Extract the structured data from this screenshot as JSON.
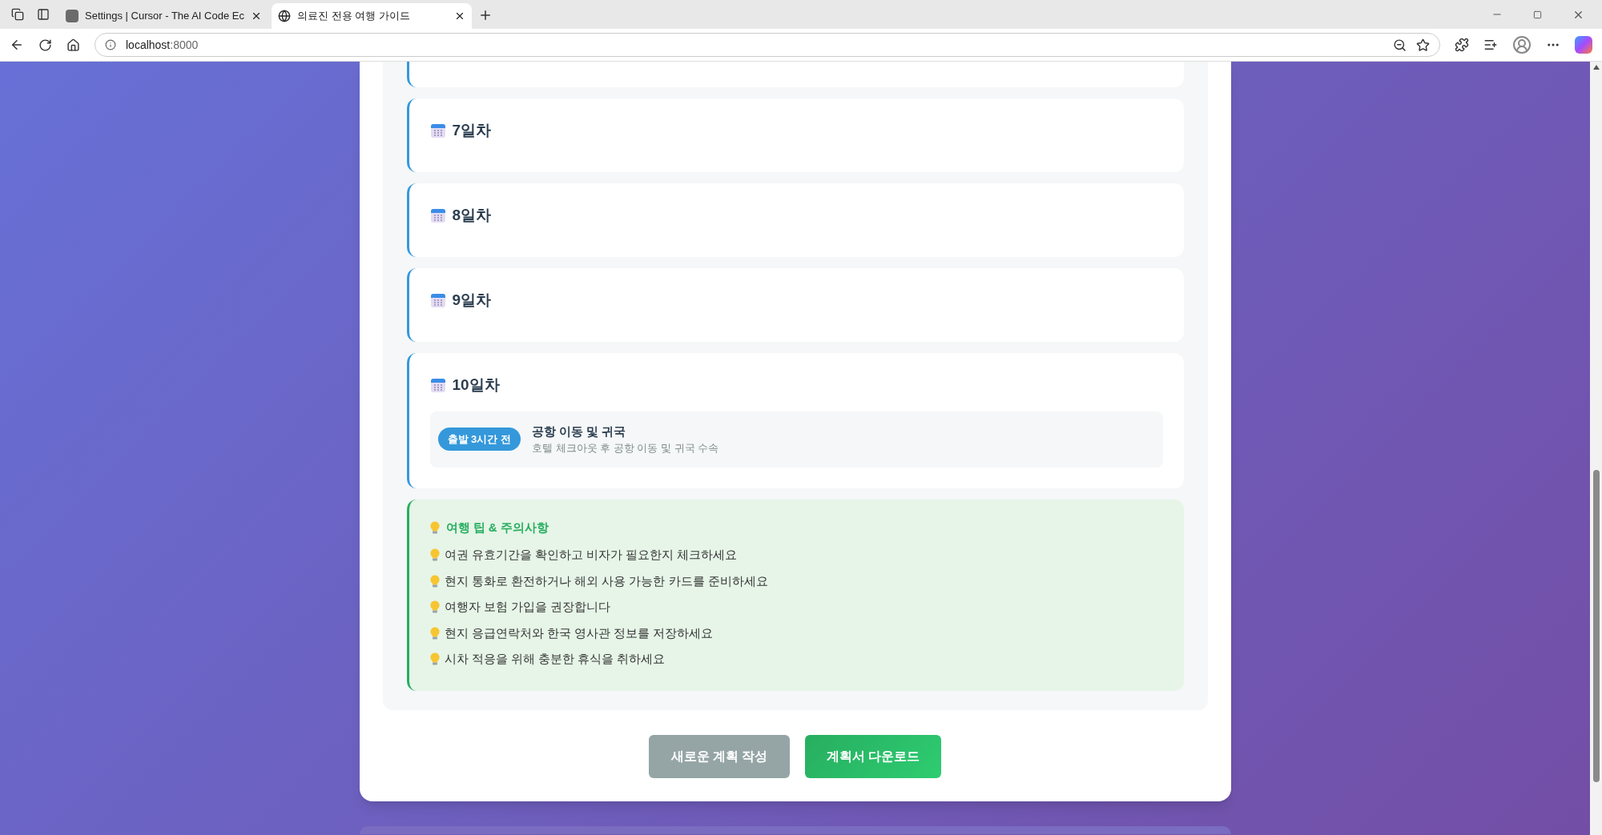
{
  "browser": {
    "tabs": [
      {
        "title": "Settings | Cursor - The AI Code Ec",
        "selected": false
      },
      {
        "title": "의료진 전용 여행 가이드",
        "selected": true
      }
    ],
    "address": {
      "host": "localhost",
      "port": ":8000"
    }
  },
  "days": [
    {
      "title": "7일차"
    },
    {
      "title": "8일차"
    },
    {
      "title": "9일차"
    },
    {
      "title": "10일차",
      "items": [
        {
          "time": "출발 3시간 전",
          "title": "공항 이동 및 귀국",
          "description": "호텔 체크아웃 후 공항 이동 및 귀국 수속"
        }
      ]
    }
  ],
  "tips": {
    "title": "여행 팁 & 주의사항",
    "items": [
      "여권 유효기간을 확인하고 비자가 필요한지 체크하세요",
      "현지 통화로 환전하거나 해외 사용 가능한 카드를 준비하세요",
      "여행자 보험 가입을 권장합니다",
      "현지 응급연락처와 한국 영사관 정보를 저장하세요",
      "시차 적응을 위해 충분한 휴식을 취하세요"
    ]
  },
  "buttons": [
    {
      "label": "새로운 계획 작성",
      "kind": "secondary"
    },
    {
      "label": "계획서 다운로드",
      "kind": "primary"
    }
  ]
}
